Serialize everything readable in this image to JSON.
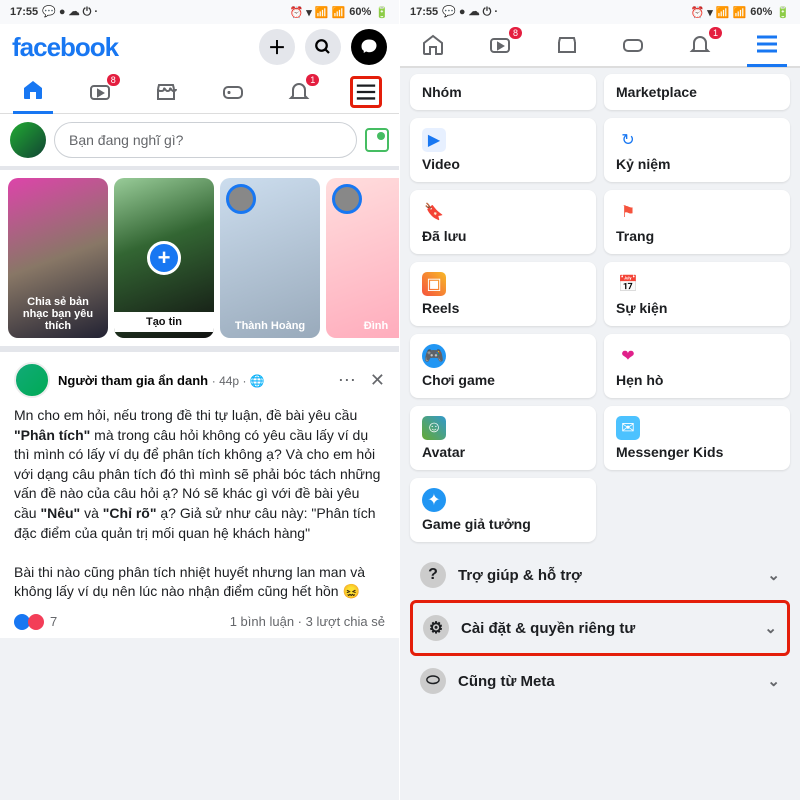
{
  "status": {
    "time": "17:55",
    "battery": "60%"
  },
  "left": {
    "logo": "facebook",
    "tabs": {
      "watch_badge": "8",
      "notif_badge": "1"
    },
    "composer": {
      "placeholder": "Bạn đang nghĩ gì?"
    },
    "stories": {
      "s1": "Chia sẻ bản nhạc bạn yêu thích",
      "s2": "Tạo tin",
      "s3": "Thành Hoàng",
      "s4": "Đình"
    },
    "post": {
      "author": "Người tham gia ẩn danh",
      "time": "44p",
      "body_pre": "Mn cho em hỏi, nếu trong đề thi tự luận, đề bài yêu cầu ",
      "b1": "\"Phân tích\"",
      "body_mid1": " mà trong câu hỏi không có yêu cầu lấy ví dụ thì mình có lấy ví dụ để phân tích không ạ? Và cho em hỏi với dạng câu phân tích đó thì mình sẽ phải bóc tách những vấn đề nào của câu hỏi ạ? Nó sẽ khác gì với đề bài yêu cầu ",
      "b2": "\"Nêu\"",
      "body_mid2": " và ",
      "b3": "\"Chỉ rõ\"",
      "body_mid3": " ạ? Giả sử như câu này: \"Phân tích đặc điểm của quản trị mối quan hệ khách hàng\"",
      "body2": "Bài thi nào cũng phân tích nhiệt huyết nhưng lan man và không lấy ví dụ nên lúc nào nhận điểm cũng hết hồn 😖",
      "react_count": "7",
      "comments": "1 bình luận",
      "shares": "3 lượt chia sẻ"
    }
  },
  "right": {
    "tabs": {
      "watch_badge": "8",
      "notif_badge": "1"
    },
    "grid": {
      "nhom": "Nhóm",
      "marketplace": "Marketplace",
      "video": "Video",
      "kyniem": "Kỷ niệm",
      "daluu": "Đã lưu",
      "trang": "Trang",
      "reels": "Reels",
      "sukien": "Sự kiện",
      "choigame": "Chơi game",
      "henho": "Hẹn hò",
      "avatar": "Avatar",
      "mkids": "Messenger Kids",
      "gamegiatuong": "Game giả tưởng"
    },
    "rows": {
      "help": "Trợ giúp & hỗ trợ",
      "settings": "Cài đặt & quyền riêng tư",
      "meta": "Cũng từ Meta"
    }
  }
}
